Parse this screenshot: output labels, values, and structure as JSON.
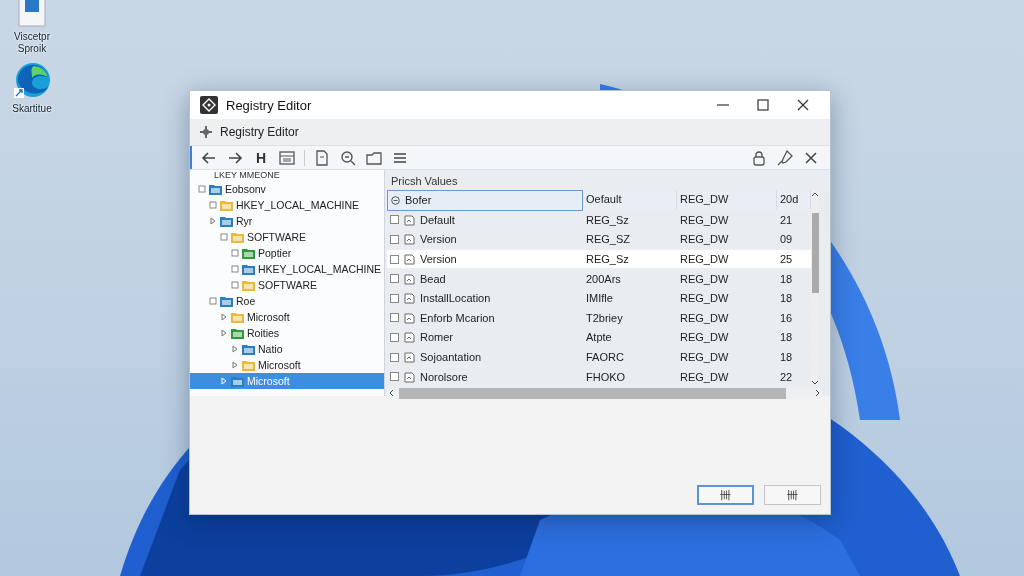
{
  "desktop_icons": [
    {
      "label": "Viscetpr Sproik",
      "kind": "file"
    },
    {
      "label": "Skartitue",
      "kind": "browser"
    }
  ],
  "window": {
    "title": "Registry Editor",
    "menu_title": "Registry Editor"
  },
  "toolbar": {
    "letter": "H"
  },
  "tree": {
    "cut_top": "LKEY MMEONE",
    "items": [
      {
        "label": "Eobsonv",
        "expanded": true,
        "selected": false,
        "children": [
          {
            "label": "HKEY_LOCAL_MACHINE",
            "expanded": true,
            "selected": false
          },
          {
            "label": "Ryr",
            "expanded": false,
            "selected": false,
            "children": [
              {
                "label": "SOFTWARE",
                "expanded": true,
                "selected": false,
                "children": [
                  {
                    "label": "Poptier",
                    "expanded": true,
                    "selected": false
                  },
                  {
                    "label": "HKEY_LOCAL_MACHINE",
                    "expanded": true,
                    "selected": false
                  },
                  {
                    "label": "SOFTWARE",
                    "expanded": true,
                    "selected": false
                  }
                ]
              }
            ]
          },
          {
            "label": "Roe",
            "expanded": true,
            "selected": false,
            "children": [
              {
                "label": "Microsoft",
                "expanded": false,
                "selected": false
              },
              {
                "label": "Roities",
                "expanded": false,
                "selected": false,
                "children": [
                  {
                    "label": "Natio",
                    "expanded": false,
                    "selected": false
                  },
                  {
                    "label": "Microsoft",
                    "expanded": false,
                    "selected": false
                  }
                ]
              },
              {
                "label": "Microsoft",
                "expanded": false,
                "selected": true
              }
            ]
          }
        ]
      }
    ]
  },
  "values": {
    "title": "Pricsh Values",
    "columns": [
      "Bofer",
      "Oefault",
      "REG_DW",
      "20d"
    ],
    "rows": [
      {
        "name": "Default",
        "data": "REG_Sz",
        "type": "REG_DW",
        "column_4": "21",
        "checked": false,
        "highlighted": false
      },
      {
        "name": "Version",
        "data": "REG_SZ",
        "type": "REG_DW",
        "column_4": "09",
        "checked": false,
        "highlighted": false
      },
      {
        "name": "Version",
        "data": "REG_Sz",
        "type": "REG_DW",
        "column_4": "25",
        "checked": false,
        "highlighted": true
      },
      {
        "name": "Bead",
        "data": "200Ars",
        "type": "REG_DW",
        "column_4": "18",
        "checked": false,
        "highlighted": false
      },
      {
        "name": "InstallLocation",
        "data": "IMIfle",
        "type": "REG_DW",
        "column_4": "18",
        "checked": false,
        "highlighted": false
      },
      {
        "name": "Enforb Mcarion",
        "data": "T2briey",
        "type": "REG_DW",
        "column_4": "16",
        "checked": false,
        "highlighted": false
      },
      {
        "name": "Romer",
        "data": "Atpte",
        "type": "REG_DW",
        "column_4": "18",
        "checked": false,
        "highlighted": false
      },
      {
        "name": "Sojoantation",
        "data": "FAORC",
        "type": "REG_DW",
        "column_4": "18",
        "checked": false,
        "highlighted": false
      },
      {
        "name": "Norolsore",
        "data": "FHOKO",
        "type": "REG_DW",
        "column_4": "22",
        "checked": false,
        "highlighted": false
      }
    ]
  },
  "buttons": [
    {
      "label": "卌",
      "selected": true
    },
    {
      "label": "卌",
      "selected": false
    }
  ]
}
